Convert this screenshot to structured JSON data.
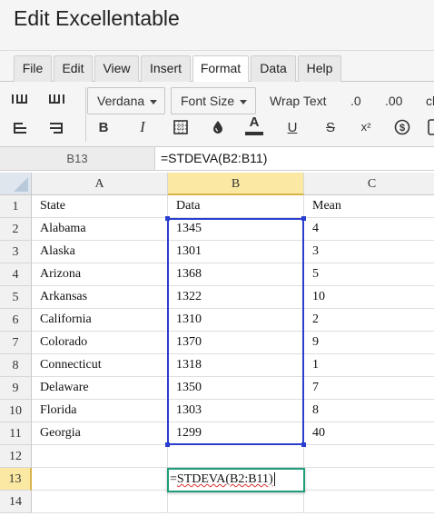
{
  "app": {
    "title": "Edit Excellentable"
  },
  "menu": {
    "tabs": [
      {
        "label": "File"
      },
      {
        "label": "Edit"
      },
      {
        "label": "View"
      },
      {
        "label": "Insert"
      },
      {
        "label": "Format",
        "active": true
      },
      {
        "label": "Data"
      },
      {
        "label": "Help"
      }
    ]
  },
  "toolbar": {
    "font_family": "Verdana",
    "font_size": "Font Size",
    "wrap_text": "Wrap Text",
    "decrease_decimal": ".0",
    "increase_decimal": ".00",
    "clear_partial": "cl",
    "bold": "B",
    "italic": "I",
    "font_color_letter": "A",
    "underline": "U",
    "strikethrough": "S",
    "superscript": "x²",
    "font_color": "#333333"
  },
  "formula_bar": {
    "cell_ref": "B13",
    "formula": "=STDEVA(B2:B11)"
  },
  "grid": {
    "columns": [
      "A",
      "B",
      "C"
    ],
    "selected_column": "B",
    "selected_row": "13",
    "rows": [
      {
        "num": "1",
        "cells": [
          "State",
          "Data",
          "Mean"
        ]
      },
      {
        "num": "2",
        "cells": [
          "Alabama",
          "1345",
          "4"
        ]
      },
      {
        "num": "3",
        "cells": [
          "Alaska",
          "1301",
          "3"
        ]
      },
      {
        "num": "4",
        "cells": [
          "Arizona",
          "1368",
          "5"
        ]
      },
      {
        "num": "5",
        "cells": [
          "Arkansas",
          "1322",
          "10"
        ]
      },
      {
        "num": "6",
        "cells": [
          "California",
          "1310",
          "2"
        ]
      },
      {
        "num": "7",
        "cells": [
          "Colorado",
          "1370",
          "9"
        ]
      },
      {
        "num": "8",
        "cells": [
          "Connecticut",
          "1318",
          "1"
        ]
      },
      {
        "num": "9",
        "cells": [
          "Delaware",
          "1350",
          "7"
        ]
      },
      {
        "num": "10",
        "cells": [
          "Florida",
          "1303",
          "8"
        ]
      },
      {
        "num": "11",
        "cells": [
          "Georgia",
          "1299",
          "40"
        ]
      },
      {
        "num": "12",
        "cells": [
          "",
          "",
          ""
        ]
      },
      {
        "num": "13",
        "cells": [
          "",
          "",
          ""
        ]
      },
      {
        "num": "14",
        "cells": [
          "",
          "",
          ""
        ]
      }
    ],
    "editor_text": "=STDEVA(B2:B11)",
    "selection_color": "#2a3fd0",
    "editor_border_color": "#1e9e7a"
  }
}
